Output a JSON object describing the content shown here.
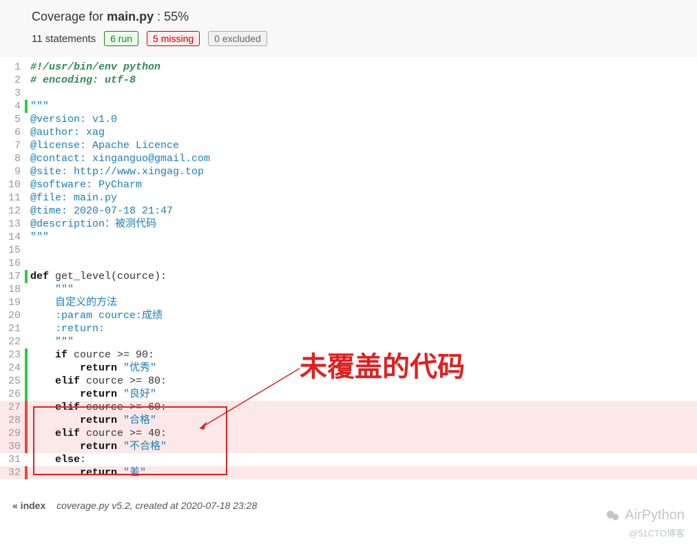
{
  "header": {
    "title_prefix": "Coverage for ",
    "filename": "main.py",
    "title_suffix": " : 55%",
    "statements": "11 statements",
    "run_badge": "6 run",
    "missing_badge": "5 missing",
    "excluded_badge": "0 excluded"
  },
  "code": {
    "lines": [
      {
        "n": 1,
        "m": "",
        "parts": [
          {
            "cls": "c-comment",
            "t": "#!/usr/bin/env python"
          }
        ]
      },
      {
        "n": 2,
        "m": "",
        "parts": [
          {
            "cls": "c-comment",
            "t": "# encoding: utf-8"
          }
        ]
      },
      {
        "n": 3,
        "m": "",
        "parts": []
      },
      {
        "n": 4,
        "m": "run",
        "parts": [
          {
            "cls": "c-docstr",
            "t": "\"\"\""
          }
        ]
      },
      {
        "n": 5,
        "m": "",
        "parts": [
          {
            "cls": "c-docstr",
            "t": "@version: v1.0"
          }
        ]
      },
      {
        "n": 6,
        "m": "",
        "parts": [
          {
            "cls": "c-docstr",
            "t": "@author: xag"
          }
        ]
      },
      {
        "n": 7,
        "m": "",
        "parts": [
          {
            "cls": "c-docstr",
            "t": "@license: Apache Licence"
          }
        ]
      },
      {
        "n": 8,
        "m": "",
        "parts": [
          {
            "cls": "c-docstr",
            "t": "@contact: xinganguo@gmail.com"
          }
        ]
      },
      {
        "n": 9,
        "m": "",
        "parts": [
          {
            "cls": "c-docstr",
            "t": "@site: http://www.xingag.top"
          }
        ]
      },
      {
        "n": 10,
        "m": "",
        "parts": [
          {
            "cls": "c-docstr",
            "t": "@software: PyCharm"
          }
        ]
      },
      {
        "n": 11,
        "m": "",
        "parts": [
          {
            "cls": "c-docstr",
            "t": "@file: main.py"
          }
        ]
      },
      {
        "n": 12,
        "m": "",
        "parts": [
          {
            "cls": "c-docstr",
            "t": "@time: 2020-07-18 21:47"
          }
        ]
      },
      {
        "n": 13,
        "m": "",
        "parts": [
          {
            "cls": "c-docstr",
            "t": "@description：被测代码"
          }
        ]
      },
      {
        "n": 14,
        "m": "",
        "parts": [
          {
            "cls": "c-docstr",
            "t": "\"\"\""
          }
        ]
      },
      {
        "n": 15,
        "m": "",
        "parts": []
      },
      {
        "n": 16,
        "m": "",
        "parts": []
      },
      {
        "n": 17,
        "m": "run",
        "parts": [
          {
            "cls": "c-kw",
            "t": "def"
          },
          {
            "cls": "c-plain",
            "t": " get_level(cource):"
          }
        ]
      },
      {
        "n": 18,
        "m": "",
        "parts": [
          {
            "cls": "c-docstr",
            "t": "    \"\"\""
          }
        ]
      },
      {
        "n": 19,
        "m": "",
        "parts": [
          {
            "cls": "c-docstr",
            "t": "    自定义的方法"
          }
        ]
      },
      {
        "n": 20,
        "m": "",
        "parts": [
          {
            "cls": "c-docstr",
            "t": "    :param cource:成绩"
          }
        ]
      },
      {
        "n": 21,
        "m": "",
        "parts": [
          {
            "cls": "c-docstr",
            "t": "    :return:"
          }
        ]
      },
      {
        "n": 22,
        "m": "",
        "parts": [
          {
            "cls": "c-docstr",
            "t": "    \"\"\""
          }
        ]
      },
      {
        "n": 23,
        "m": "run",
        "parts": [
          {
            "cls": "c-plain",
            "t": "    "
          },
          {
            "cls": "c-kw",
            "t": "if"
          },
          {
            "cls": "c-plain",
            "t": " cource >= 90:"
          }
        ]
      },
      {
        "n": 24,
        "m": "run",
        "parts": [
          {
            "cls": "c-plain",
            "t": "        "
          },
          {
            "cls": "c-kw",
            "t": "return"
          },
          {
            "cls": "c-plain",
            "t": " "
          },
          {
            "cls": "c-str",
            "t": "\"优秀\""
          }
        ]
      },
      {
        "n": 25,
        "m": "run",
        "parts": [
          {
            "cls": "c-plain",
            "t": "    "
          },
          {
            "cls": "c-kw",
            "t": "elif"
          },
          {
            "cls": "c-plain",
            "t": " cource >= 80:"
          }
        ]
      },
      {
        "n": 26,
        "m": "run",
        "parts": [
          {
            "cls": "c-plain",
            "t": "        "
          },
          {
            "cls": "c-kw",
            "t": "return"
          },
          {
            "cls": "c-plain",
            "t": " "
          },
          {
            "cls": "c-str",
            "t": "\"良好\""
          }
        ]
      },
      {
        "n": 27,
        "m": "miss",
        "parts": [
          {
            "cls": "c-plain",
            "t": "    "
          },
          {
            "cls": "c-kw",
            "t": "elif"
          },
          {
            "cls": "c-plain",
            "t": " cource >= 60:"
          }
        ]
      },
      {
        "n": 28,
        "m": "miss",
        "parts": [
          {
            "cls": "c-plain",
            "t": "        "
          },
          {
            "cls": "c-kw",
            "t": "return"
          },
          {
            "cls": "c-plain",
            "t": " "
          },
          {
            "cls": "c-str",
            "t": "\"合格\""
          }
        ]
      },
      {
        "n": 29,
        "m": "miss",
        "parts": [
          {
            "cls": "c-plain",
            "t": "    "
          },
          {
            "cls": "c-kw",
            "t": "elif"
          },
          {
            "cls": "c-plain",
            "t": " cource >= 40:"
          }
        ]
      },
      {
        "n": 30,
        "m": "miss",
        "parts": [
          {
            "cls": "c-plain",
            "t": "        "
          },
          {
            "cls": "c-kw",
            "t": "return"
          },
          {
            "cls": "c-plain",
            "t": " "
          },
          {
            "cls": "c-str",
            "t": "\"不合格\""
          }
        ]
      },
      {
        "n": 31,
        "m": "",
        "parts": [
          {
            "cls": "c-plain",
            "t": "    "
          },
          {
            "cls": "c-kw",
            "t": "else"
          },
          {
            "cls": "c-plain",
            "t": ":"
          }
        ]
      },
      {
        "n": 32,
        "m": "miss",
        "parts": [
          {
            "cls": "c-plain",
            "t": "        "
          },
          {
            "cls": "c-kw",
            "t": "return"
          },
          {
            "cls": "c-plain",
            "t": " "
          },
          {
            "cls": "c-str",
            "t": "\"差\""
          }
        ]
      }
    ]
  },
  "footer": {
    "index_link": "« index",
    "generated": "coverage.py v5.2, created at 2020-07-18 23:28"
  },
  "annotation": {
    "label": "未覆盖的代码"
  },
  "watermark": {
    "name": "AirPython",
    "sub": "@51CTO博客"
  }
}
